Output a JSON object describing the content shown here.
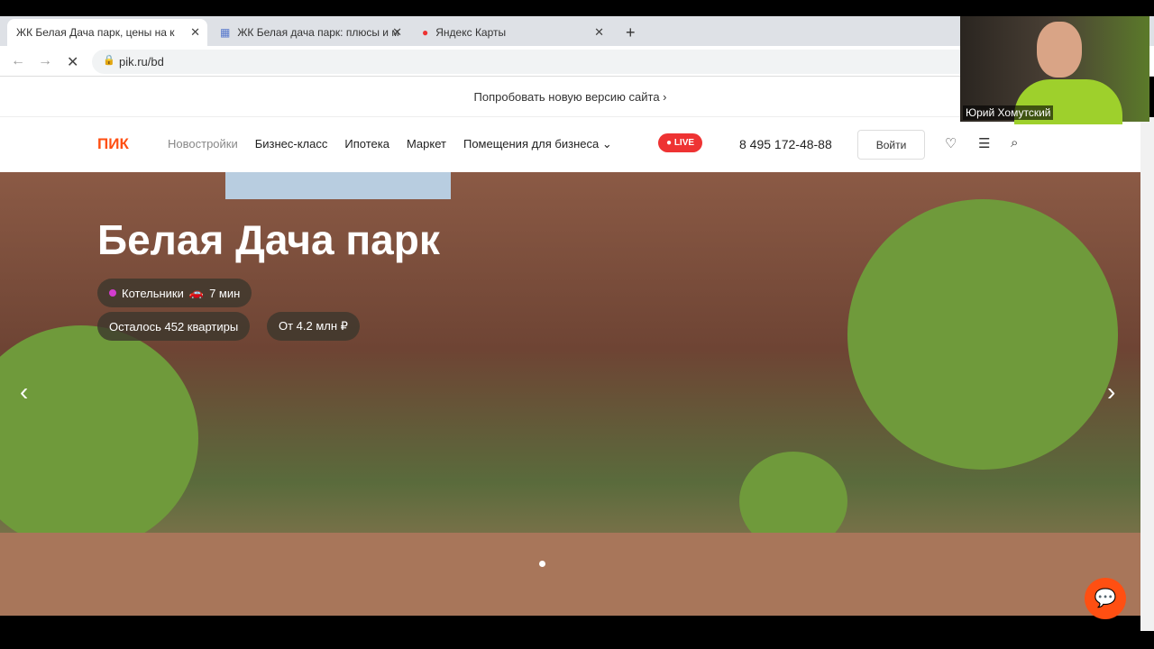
{
  "browser": {
    "tabs": [
      {
        "title": "ЖК Белая Дача парк, цены на к"
      },
      {
        "title": "ЖК Белая дача парк: плюсы и м"
      },
      {
        "title": "Яндекс Карты"
      }
    ],
    "url": "pik.ru/bd"
  },
  "promo": "Попробовать новую версию сайта ›",
  "header": {
    "logo": "ПИК",
    "menu": [
      "Новостройки",
      "Бизнес-класс",
      "Ипотека",
      "Маркет",
      "Помещения для бизнеса ⌄"
    ],
    "live": "● LIVE",
    "phone": "8 495 172-48-88",
    "login": "Войти"
  },
  "hero": {
    "title": "Белая Дача парк",
    "station": "Котельники",
    "travel": "7 мин",
    "remaining": "Осталось 452 квартиры",
    "price": "От 4.2 млн ₽"
  },
  "webcam": {
    "name": "Юрий Хомутский"
  },
  "colors": {
    "brand": "#ff4f12",
    "live": "#e33333"
  }
}
